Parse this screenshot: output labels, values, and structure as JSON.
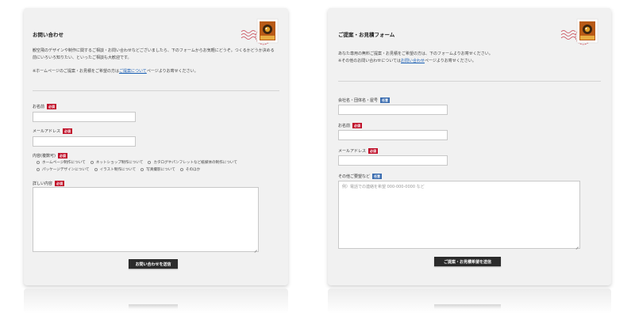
{
  "left_form": {
    "title": "お問い合わせ",
    "intro_line1": "観空飛のデザインや制作に関するご相談・お問い合わせなどございましたら、下のフォームからお気軽にどうぞ。つくるかどうか決める",
    "intro_line2": "前にいろいろ知りたい、といったご相談も大歓迎です。",
    "note_prefix": "※ホームページのご提案・お見積をご希望の方は",
    "note_link": "ご提案について",
    "note_suffix": "ページよりお寄せください。",
    "name_label": "お名前",
    "email_label": "メールアドレス",
    "content_label": "内容(複数可)",
    "checkbox_options": [
      "ホームページ制作について",
      "ネットショップ制作について",
      "カタログやパンフレットなど紙媒体の制作について",
      "パッケージデザインについて",
      "イラスト制作について",
      "写真撮影について",
      "そのほか"
    ],
    "detail_label": "詳しい内容",
    "submit_label": "お問い合わせを送信"
  },
  "right_form": {
    "title": "ご提案・お見積フォーム",
    "intro_line1": "あなた専用の無料ご提案・お見積をご希望の方は、下のフォームよりお寄せください。",
    "note_prefix": "※その他のお問い合わせについては",
    "note_link": "お問い合わせ",
    "note_suffix": "ページよりお寄せください。",
    "company_label": "会社名・団体名・屋号",
    "name_label": "お名前",
    "email_label": "メールアドレス",
    "request_label": "その他ご要望など",
    "request_placeholder": "例）電話での連絡を希望 000-000-0000 など",
    "submit_label": "ご提案・お見積希望を送信"
  },
  "badges": {
    "required": "必須",
    "optional": "任意"
  },
  "colors": {
    "required_badge": "#c0102a",
    "optional_badge": "#3b6db0",
    "button": "#2b2b2b",
    "link": "#1a5fb4",
    "card": "#f1f1f1"
  },
  "icons": {
    "stamp": "postage-stamp-icon",
    "postmark": "postmark-wave-icon"
  }
}
